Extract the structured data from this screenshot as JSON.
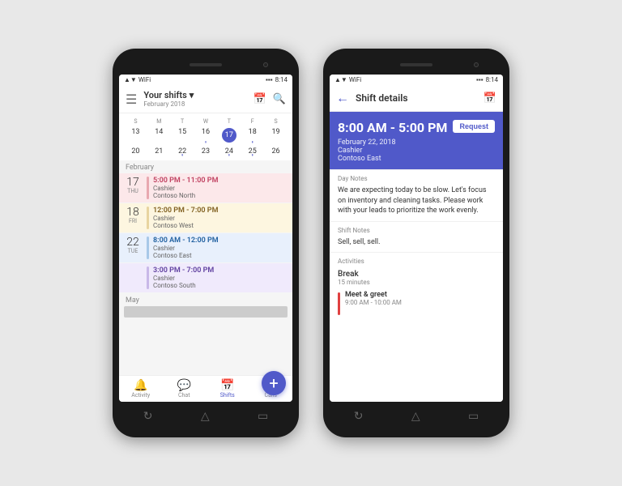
{
  "scene": {
    "background": "#e8e8e8"
  },
  "phone1": {
    "status_bar": {
      "time": "8:14",
      "signal": "▲▼",
      "wifi": "WiFi",
      "battery": "🔋"
    },
    "header": {
      "title": "Your shifts",
      "title_arrow": "▾",
      "subtitle": "February 2018",
      "menu_icon": "☰",
      "schedule_icon": "📅",
      "search_icon": "🔍"
    },
    "calendar": {
      "day_labels": [
        "S",
        "M",
        "T",
        "W",
        "T",
        "F",
        "S"
      ],
      "weeks": [
        [
          {
            "num": "13",
            "dot": false,
            "today": false
          },
          {
            "num": "14",
            "dot": false,
            "today": false
          },
          {
            "num": "15",
            "dot": false,
            "today": false
          },
          {
            "num": "16",
            "dot": true,
            "today": false
          },
          {
            "num": "17",
            "dot": true,
            "today": true
          },
          {
            "num": "18",
            "dot": true,
            "today": false
          },
          {
            "num": "19",
            "dot": false,
            "today": false
          }
        ],
        [
          {
            "num": "20",
            "dot": false,
            "today": false
          },
          {
            "num": "21",
            "dot": false,
            "today": false
          },
          {
            "num": "22",
            "dot": true,
            "today": false
          },
          {
            "num": "23",
            "dot": false,
            "today": false
          },
          {
            "num": "24",
            "dot": true,
            "today": false
          },
          {
            "num": "25",
            "dot": true,
            "today": false
          },
          {
            "num": "26",
            "dot": false,
            "today": false
          }
        ]
      ]
    },
    "month_section": "February",
    "shifts": [
      {
        "date_num": "17",
        "date_day": "THU",
        "time": "5:00 PM - 11:00 PM",
        "role": "Cashier",
        "location": "Contoso North",
        "color_class": "color-pink",
        "text_class": "text-pink",
        "bg_class": "bg-pink-light"
      },
      {
        "date_num": "18",
        "date_day": "FRI",
        "time": "12:00 PM - 7:00 PM",
        "role": "Cashier",
        "location": "Contoso West",
        "color_class": "color-yellow",
        "text_class": "text-yellow",
        "bg_class": "bg-yellow-light"
      },
      {
        "date_num": "22",
        "date_day": "TUE",
        "time": "8:00 AM - 12:00 PM",
        "role": "Cashier",
        "location": "Contoso East",
        "color_class": "color-blue",
        "text_class": "text-blue",
        "bg_class": "bg-blue-light"
      },
      {
        "date_num": "",
        "date_day": "",
        "time": "3:00 PM - 7:00 PM",
        "role": "Cashier",
        "location": "Contoso South",
        "color_class": "color-purple",
        "text_class": "text-purple",
        "bg_class": "bg-purple-light"
      }
    ],
    "month_section2": "May",
    "nav": [
      {
        "label": "Activity",
        "icon": "🔔",
        "active": false
      },
      {
        "label": "Chat",
        "icon": "💬",
        "active": false
      },
      {
        "label": "Shifts",
        "icon": "📅",
        "active": true
      },
      {
        "label": "Calls",
        "icon": "📞",
        "active": false
      }
    ],
    "fab": "+"
  },
  "phone2": {
    "status_bar": {
      "time": "8:14"
    },
    "header": {
      "back_icon": "←",
      "title": "Shift details",
      "schedule_icon": "📅"
    },
    "hero": {
      "time_range": "8:00 AM - 5:00 PM",
      "request_label": "Request",
      "date": "February 22, 2018",
      "role": "Cashier",
      "location": "Contoso East"
    },
    "sections": {
      "day_notes_label": "Day Notes",
      "day_notes_text": "We are expecting today to be slow. Let's focus on inventory and cleaning tasks. Please work with your leads to prioritize the work evenly.",
      "shift_notes_label": "Shift Notes",
      "shift_notes_text": "Sell, sell, sell.",
      "activities_label": "Activities",
      "break_name": "Break",
      "break_duration": "15 minutes",
      "activity_name": "Meet & greet",
      "activity_time": "9:00 AM - 10:00 AM"
    }
  }
}
